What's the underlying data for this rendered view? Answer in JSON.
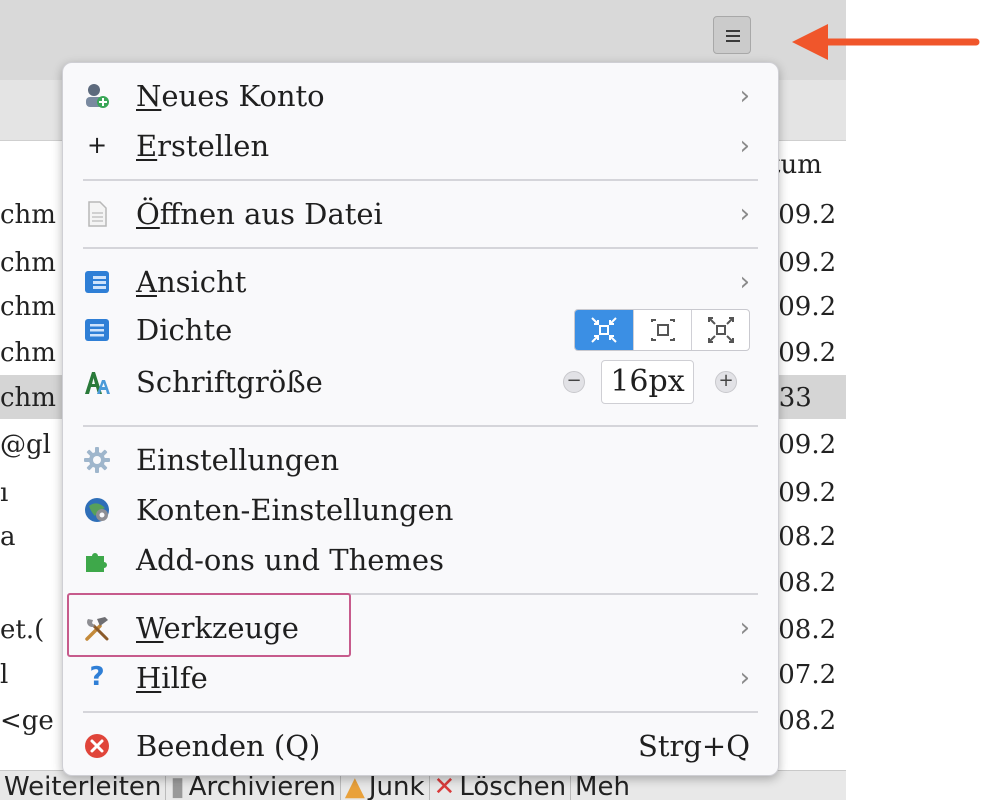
{
  "menu_button": {
    "icon": "hamburger-menu-icon"
  },
  "annotation": {
    "arrow_color": "#f0562b",
    "highlight_color": "#c75b8c"
  },
  "background": {
    "column_header_right": "tum",
    "left_column": [
      "chm",
      "chm",
      "chm",
      "chm",
      "chm",
      "@gl",
      "ı",
      "a",
      "",
      "et.(",
      "l",
      "<ge"
    ],
    "right_column": [
      ".09.2",
      ".09.2",
      ".09.2",
      ".09.2",
      ":33",
      ".09.2",
      ".09.2",
      ".08.2",
      ".08.2",
      ".08.2",
      ".07.2",
      ".08.2"
    ],
    "bottom_toolbar": [
      "Weiterleiten",
      "Archivieren",
      "Junk",
      "Löschen",
      "Meh"
    ]
  },
  "menu": {
    "new_account": {
      "label_u": "N",
      "label_rest": "eues Konto",
      "icon": "new-account-icon"
    },
    "create": {
      "label_u": "E",
      "label_rest": "rstellen",
      "icon": "plus-icon"
    },
    "open_file": {
      "label_u": "Ö",
      "label_rest": "ffnen aus Datei",
      "icon": "file-icon"
    },
    "view": {
      "label_u": "A",
      "label_rest": "nsicht",
      "icon": "layout-view-icon"
    },
    "density": {
      "label": "Dichte",
      "icon": "density-icon",
      "options": [
        "compact",
        "normal",
        "touch"
      ],
      "selected": "compact"
    },
    "font_size": {
      "label": "Schriftgröße",
      "icon": "font-size-icon",
      "value": "16px",
      "decrease": "−",
      "increase": "+"
    },
    "settings": {
      "label": "Einstellungen",
      "icon": "gear-icon"
    },
    "account_settings": {
      "label": "Konten-Einstellungen",
      "icon": "account-settings-icon"
    },
    "addons": {
      "label": "Add-ons und Themes",
      "icon": "puzzle-icon"
    },
    "tools": {
      "label_u": "W",
      "label_rest": "erkzeuge",
      "icon": "tools-icon"
    },
    "help": {
      "label_u": "H",
      "label_rest": "ilfe",
      "icon": "help-icon"
    },
    "quit": {
      "label": "Beenden (Q)",
      "shortcut": "Strg+Q",
      "icon": "quit-icon"
    },
    "chevron": "›"
  }
}
